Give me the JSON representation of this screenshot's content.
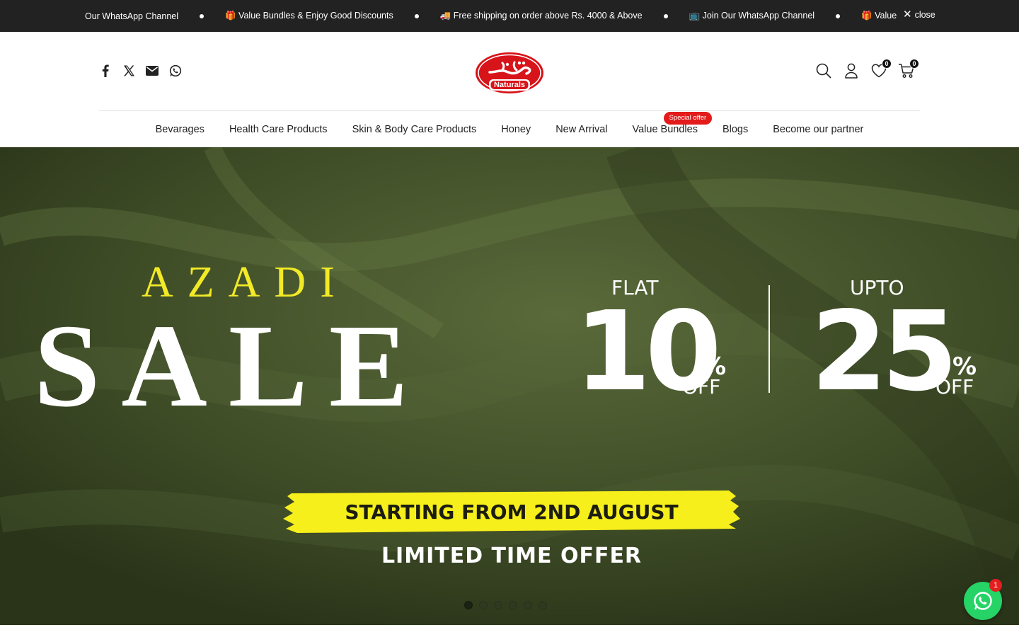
{
  "announcement": {
    "items": [
      "Our WhatsApp Channel",
      "🎁 Value Bundles & Enjoy Good Discounts",
      "🚚 Free shipping on order above Rs. 4000 & Above",
      "📺 Join Our WhatsApp Channel",
      "🎁 Value Bundles & Enjoy Good Discounts"
    ],
    "close_label": "close"
  },
  "header": {
    "logo_text": "Naturals",
    "logo_script": "اشرف",
    "wishlist_count": "0",
    "cart_count": "0"
  },
  "nav": {
    "items": [
      {
        "label": "Bevarages"
      },
      {
        "label": "Health Care Products"
      },
      {
        "label": "Skin & Body Care Products"
      },
      {
        "label": "Honey"
      },
      {
        "label": "New Arrival"
      },
      {
        "label": "Value Bundles",
        "tag": "Special offer"
      },
      {
        "label": "Blogs"
      },
      {
        "label": "Become our partner"
      }
    ]
  },
  "hero": {
    "title_top": "AZADI",
    "title_main": "SALE",
    "offer1": {
      "label": "FLAT",
      "value": "10",
      "pct": "%",
      "off": "OFF"
    },
    "offer2": {
      "label": "UPTO",
      "value": "25",
      "pct": "%",
      "off": "OFF"
    },
    "starting": "STARTING FROM 2ND AUGUST",
    "limited": "LIMITED TIME OFFER",
    "slide_count": 6,
    "active_slide": 1
  },
  "whatsapp": {
    "badge": "1"
  },
  "colors": {
    "topbar": "#222222",
    "accent_red": "#e31b1b",
    "hero_green": "#3d4a25",
    "sale_yellow": "#f2ea26",
    "whatsapp": "#25d366"
  }
}
